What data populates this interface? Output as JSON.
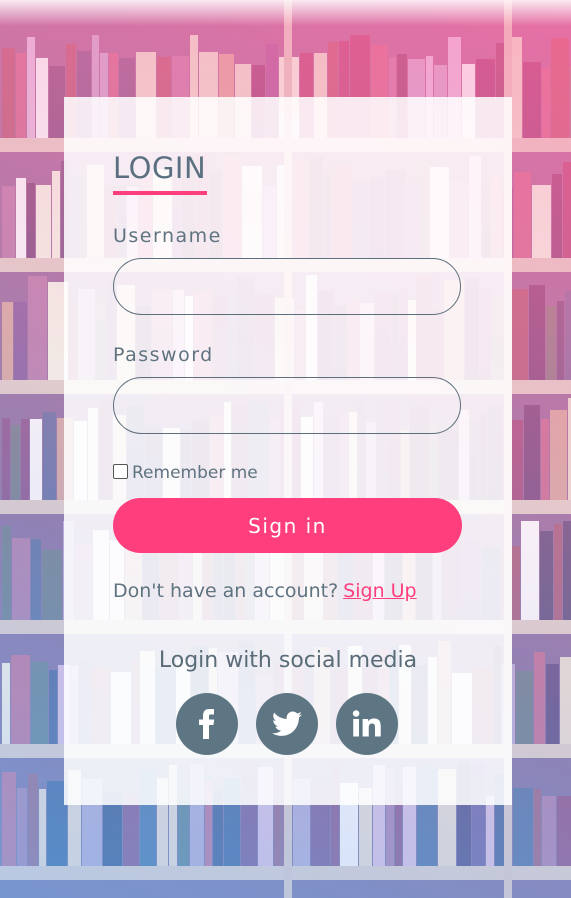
{
  "login": {
    "title": "LOGIN",
    "username_label": "Username",
    "username_value": "",
    "password_label": "Password",
    "password_value": "",
    "remember_label": "Remember me",
    "remember_checked": false,
    "signin_label": "Sign in",
    "no_account_text": "Don't have an account?",
    "signup_label": "Sign Up"
  },
  "social": {
    "title": "Login with social media",
    "buttons": [
      {
        "icon": "facebook-icon"
      },
      {
        "icon": "twitter-icon"
      },
      {
        "icon": "linkedin-icon"
      }
    ]
  },
  "colors": {
    "accent": "#ff3f7d",
    "text": "#5f7380",
    "social_button": "#5e7683",
    "card": "#ffffff"
  }
}
